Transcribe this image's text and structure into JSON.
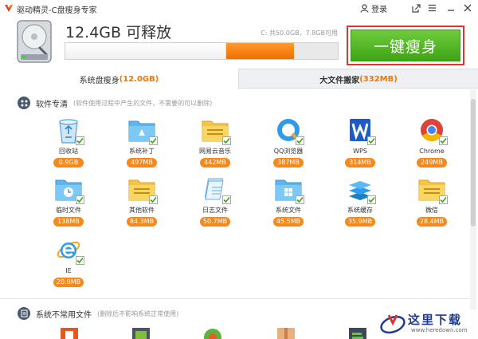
{
  "window": {
    "title": "驱动精灵-C盘瘦身专家",
    "login_label": "登录"
  },
  "header": {
    "free_space": "12.4GB 可释放",
    "disk_info": "C: 共50.0GB，7.8GB可用",
    "used_fraction": 0.59,
    "freeable_fraction": 0.25,
    "slim_button": "一键瘦身"
  },
  "tabs": [
    {
      "label": "系统盘瘦身",
      "size": "(12.0GB)"
    },
    {
      "label": "大文件搬家",
      "size": "(332MB)"
    }
  ],
  "software_section": {
    "title": "软件专清",
    "note": "(软件使用过程中产生的文件，不需要的可以删除)",
    "items": [
      {
        "label": "回收站",
        "size": "0.9GB",
        "icon": "recycle-bin-icon"
      },
      {
        "label": "系统补丁",
        "size": "497MB",
        "icon": "patch-folder-icon"
      },
      {
        "label": "网易云音乐",
        "size": "442MB",
        "icon": "music-folder-icon"
      },
      {
        "label": "QQ浏览器",
        "size": "387MB",
        "icon": "qq-browser-icon"
      },
      {
        "label": "WPS",
        "size": "314MB",
        "icon": "wps-icon"
      },
      {
        "label": "Chrome",
        "size": "249MB",
        "icon": "chrome-icon"
      },
      {
        "label": "临时文件",
        "size": "138MB",
        "icon": "temp-folder-icon"
      },
      {
        "label": "其他软件",
        "size": "84.3MB",
        "icon": "software-folder-icon"
      },
      {
        "label": "日志文件",
        "size": "50.7MB",
        "icon": "log-file-icon"
      },
      {
        "label": "系统文件",
        "size": "45.5MB",
        "icon": "system-folder-icon"
      },
      {
        "label": "系统缓存",
        "size": "35.9MB",
        "icon": "cache-layers-icon"
      },
      {
        "label": "微信",
        "size": "28.4MB",
        "icon": "wechat-folder-icon"
      },
      {
        "label": "IE",
        "size": "20.9MB",
        "icon": "ie-icon"
      }
    ]
  },
  "rare_section": {
    "title": "系统不常用文件",
    "note": "(删除后不影响系统正常使用)"
  },
  "watermark": {
    "text": "这里下载",
    "url": "www.heredown.com"
  },
  "colors": {
    "accent_orange": "#f5891c",
    "button_green": "#4cb420",
    "highlight_red": "#e23232"
  }
}
